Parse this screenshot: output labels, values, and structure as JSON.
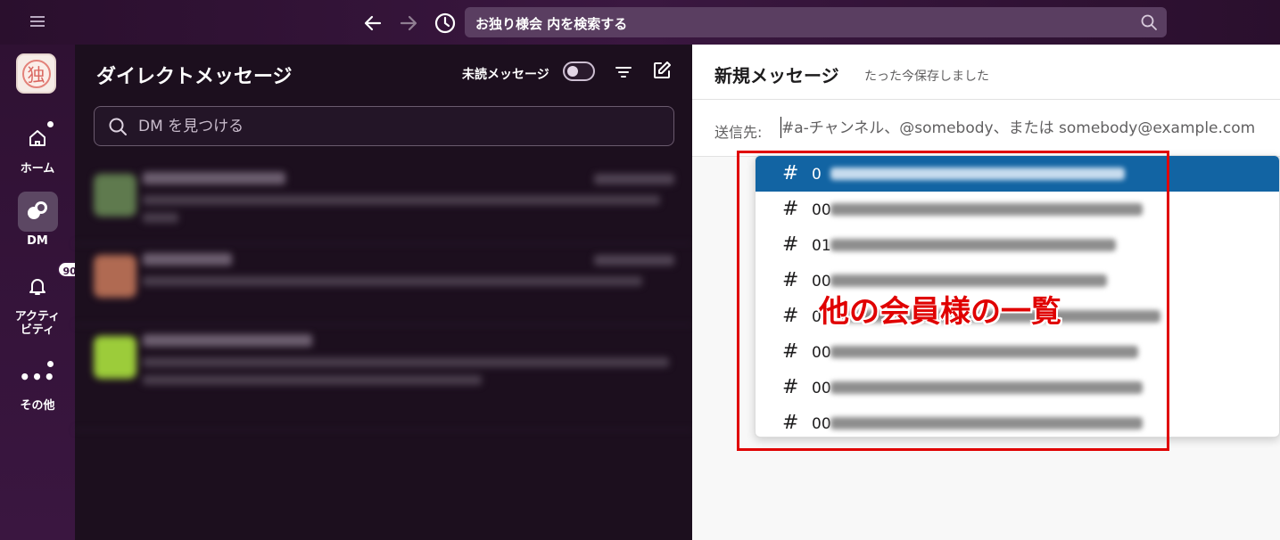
{
  "topbar": {
    "search_text": "お独り様会 内を検索する",
    "icons": [
      "hamburger-icon",
      "back-arrow-icon",
      "forward-arrow-icon",
      "history-icon",
      "search-icon"
    ]
  },
  "rail": {
    "workspace_logo_char": "独",
    "items": [
      {
        "label": "ホーム",
        "icon": "home-icon",
        "has_dot": true
      },
      {
        "label": "DM",
        "icon": "dm-icon",
        "active": true
      },
      {
        "label": "アクティビティ",
        "label_line1": "アクティ",
        "label_line2": "ビティ",
        "icon": "bell-icon",
        "badge": "90"
      },
      {
        "label": "その他",
        "icon": "more-icon",
        "dots": "•••",
        "has_dot": true
      }
    ]
  },
  "dm_panel": {
    "title": "ダイレクトメッセージ",
    "unread_label": "未読メッセージ",
    "unread_toggle_on": false,
    "search_placeholder": "DM を見つける"
  },
  "main": {
    "title": "新規メッセージ",
    "saved_status": "たった今保存しました",
    "to_label": "送信先:",
    "to_placeholder": "#a-チャンネル、@somebody、または somebody@example.com",
    "channels": [
      {
        "hash": "#",
        "prefix": "0",
        "selected": true
      },
      {
        "hash": "#",
        "prefix": "00"
      },
      {
        "hash": "#",
        "prefix": "01"
      },
      {
        "hash": "#",
        "prefix": "00"
      },
      {
        "hash": "#",
        "prefix": "0"
      },
      {
        "hash": "#",
        "prefix": "00"
      },
      {
        "hash": "#",
        "prefix": "00"
      },
      {
        "hash": "#",
        "prefix": "00"
      }
    ],
    "annotation": "他の会員様の一覧"
  },
  "colors": {
    "sidebar": "#2a0f2d",
    "dm_panel": "#1c0f1e",
    "selection": "#1264a3",
    "annotation": "#e00000"
  }
}
